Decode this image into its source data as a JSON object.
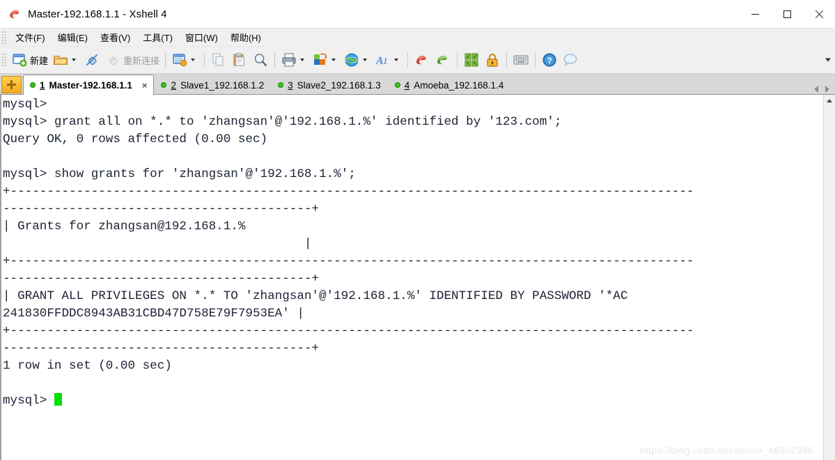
{
  "window": {
    "title": "Master-192.168.1.1 - Xshell 4",
    "app_icon": "xshell-icon",
    "controls": {
      "minimize": "minimize-button",
      "maximize": "maximize-button",
      "close": "close-button"
    }
  },
  "menubar": {
    "items": [
      {
        "label": "文件(F)",
        "name": "menu-file"
      },
      {
        "label": "编辑(E)",
        "name": "menu-edit"
      },
      {
        "label": "查看(V)",
        "name": "menu-view"
      },
      {
        "label": "工具(T)",
        "name": "menu-tools"
      },
      {
        "label": "窗口(W)",
        "name": "menu-window"
      },
      {
        "label": "帮助(H)",
        "name": "menu-help"
      }
    ]
  },
  "toolbar": {
    "new_label": "新建",
    "reconnect_label": "重新连接",
    "items": [
      "new-session-icon",
      "open-folder-icon",
      "connect-icon",
      "disconnect-icon",
      "session-manager-icon",
      "copy-icon",
      "paste-icon",
      "find-icon",
      "print-icon",
      "layout-icon",
      "globe-icon",
      "font-icon",
      "xshell-icon",
      "xftp-icon",
      "fullscreen-icon",
      "lock-icon",
      "keyboard-icon",
      "help-icon",
      "chat-icon"
    ],
    "overflow": "toolbar-overflow-chevron"
  },
  "tabs": {
    "new_tab_label": "+",
    "items": [
      {
        "num": "1",
        "label": "Master-192.168.1.1",
        "active": true,
        "status": "connected"
      },
      {
        "num": "2",
        "label": "Slave1_192.168.1.2",
        "active": false,
        "status": "connected"
      },
      {
        "num": "3",
        "label": "Slave2_192.168.1.3",
        "active": false,
        "status": "connected"
      },
      {
        "num": "4",
        "label": "Amoeba_192.168.1.4",
        "active": false,
        "status": "connected"
      }
    ],
    "close_glyph": "×"
  },
  "terminal": {
    "lines": [
      "mysql>",
      "mysql> grant all on *.* to 'zhangsan'@'192.168.1.%' identified by '123.com';",
      "Query OK, 0 rows affected (0.00 sec)",
      "",
      "mysql> show grants for 'zhangsan'@'192.168.1.%';",
      "+---------------------------------------------------------------------------------------------",
      "------------------------------------------+",
      "| Grants for zhangsan@192.168.1.%",
      "                                         |",
      "+---------------------------------------------------------------------------------------------",
      "------------------------------------------+",
      "| GRANT ALL PRIVILEGES ON *.* TO 'zhangsan'@'192.168.1.%' IDENTIFIED BY PASSWORD '*AC",
      "241830FFDDC8943AB31CBD47D758E79F7953EA' |",
      "+---------------------------------------------------------------------------------------------",
      "------------------------------------------+",
      "1 row in set (0.00 sec)",
      "",
      "mysql> "
    ],
    "prompt_line_index": 17,
    "cursor": {
      "visible": true,
      "color": "#00e000"
    },
    "fg_color": "#1b2233",
    "bg_color": "#ffffff"
  },
  "watermark": {
    "text": "https://blog.csdn.net/weixin_46902396"
  },
  "scrollbar": {
    "up_arrow": "scroll-up-arrow"
  }
}
